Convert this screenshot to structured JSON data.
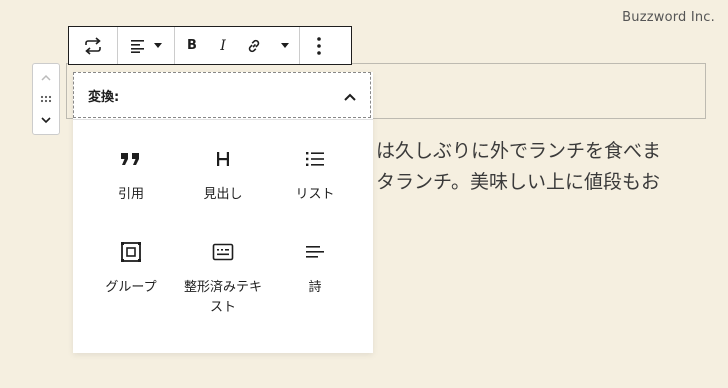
{
  "watermark": "Buzzword Inc.",
  "paragraph": {
    "line1": "は久しぶりに外でランチを食べま",
    "line2": "タランチ。美味しい上に値段もお"
  },
  "toolbar": {
    "transform_icon": "transform-arrows-icon",
    "align_icon": "align-left-icon",
    "bold_label": "B",
    "italic_label": "I",
    "link_icon": "link-icon",
    "more_icon": "more-vertical-icon"
  },
  "popover": {
    "title": "変換:",
    "items": [
      {
        "label": "引用",
        "icon": "quote-icon"
      },
      {
        "label": "見出し",
        "icon": "heading-icon"
      },
      {
        "label": "リスト",
        "icon": "list-icon"
      },
      {
        "label": "グループ",
        "icon": "group-icon"
      },
      {
        "label": "整形済みテキ",
        "label2": "スト",
        "icon": "preformatted-icon"
      },
      {
        "label": "詩",
        "icon": "verse-icon"
      }
    ]
  }
}
